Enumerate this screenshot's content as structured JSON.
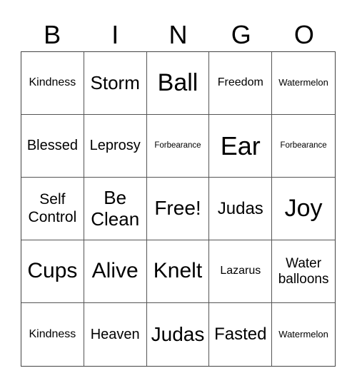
{
  "header": [
    "B",
    "I",
    "N",
    "G",
    "O"
  ],
  "cells": [
    "Kindness",
    "Storm",
    "Ball",
    "Freedom",
    "Watermelon",
    "Blessed",
    "Leprosy",
    "Forbearance",
    "Ear",
    "Forbearance",
    "Self Control",
    "Be Clean",
    "Free!",
    "Judas",
    "Joy",
    "Cups",
    "Alive",
    "Knelt",
    "Lazarus",
    "Water balloons",
    "Kindness",
    "Heaven",
    "Judas",
    "Fasted",
    "Watermelon"
  ]
}
